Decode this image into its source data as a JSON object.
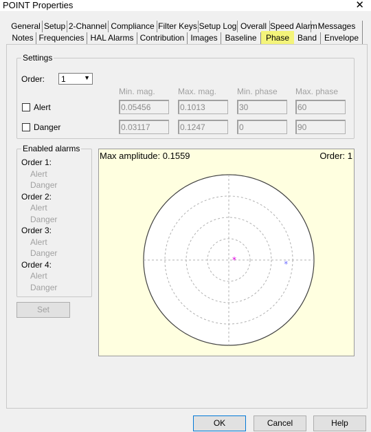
{
  "window": {
    "title": "POINT Properties",
    "close_icon": "close-icon"
  },
  "tabs_row1": [
    "General",
    "Setup",
    "2-Channel",
    "Compliance",
    "Filter Keys",
    "Setup Log",
    "Overall",
    "Speed Alarm",
    "Messages"
  ],
  "tabs_row2": [
    "Notes",
    "Frequencies",
    "HAL Alarms",
    "Contribution",
    "Images",
    "Baseline",
    "Phase",
    "Band",
    "Envelope"
  ],
  "active_tab": "Phase",
  "active_tab_color": "#f4f47a",
  "settings": {
    "label": "Settings",
    "order_label": "Order:",
    "order_value": "1",
    "columns": [
      "Min. mag.",
      "Max. mag.",
      "Min. phase",
      "Max. phase"
    ],
    "rows": [
      {
        "label": "Alert",
        "checked": false,
        "values": [
          "0.05456",
          "0.1013",
          "30",
          "60"
        ]
      },
      {
        "label": "Danger",
        "checked": false,
        "values": [
          "0.03117",
          "0.1247",
          "0",
          "90"
        ]
      }
    ]
  },
  "enabled_alarms": {
    "label": "Enabled alarms",
    "orders": [
      {
        "label": "Order 1:",
        "items": [
          "Alert",
          "Danger"
        ]
      },
      {
        "label": "Order 2:",
        "items": [
          "Alert",
          "Danger"
        ]
      },
      {
        "label": "Order 3:",
        "items": [
          "Alert",
          "Danger"
        ]
      },
      {
        "label": "Order 4:",
        "items": [
          "Alert",
          "Danger"
        ]
      }
    ]
  },
  "set_button": "Set",
  "chart_data": {
    "type": "polar",
    "max_amplitude_label": "Max amplitude: 0.1559",
    "order_label": "Order: 1",
    "r_max": 0.1559,
    "rings": 4,
    "background": "#ffffe0",
    "points": [
      {
        "magnitude": 0.01,
        "phase_deg": 0,
        "color": "#e000e0"
      },
      {
        "magnitude": 0.105,
        "phase_deg": -4,
        "color": "#7070ff"
      }
    ]
  },
  "footer": {
    "ok": "OK",
    "cancel": "Cancel",
    "help": "Help"
  }
}
